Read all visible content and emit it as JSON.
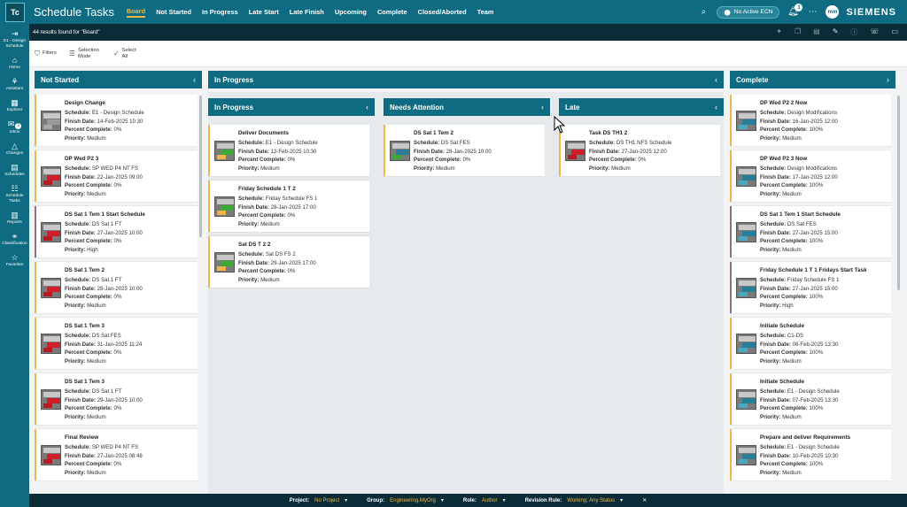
{
  "app": {
    "logo": "Tc",
    "title": "Schedule Tasks"
  },
  "nav_tabs": [
    {
      "label": "Board",
      "active": true
    },
    {
      "label": "Not Started",
      "active": false
    },
    {
      "label": "In Progress",
      "active": false
    },
    {
      "label": "Late Start",
      "active": false
    },
    {
      "label": "Late Finish",
      "active": false
    },
    {
      "label": "Upcoming",
      "active": false
    },
    {
      "label": "Complete",
      "active": false
    },
    {
      "label": "Closed/Aborted",
      "active": false
    },
    {
      "label": "Team",
      "active": false
    }
  ],
  "header": {
    "ecn_label": "No Active ECN",
    "notif_count": "1",
    "avatar_initials": "mm",
    "brand": "SIEMENS"
  },
  "sidebar": [
    {
      "label": "E1 - Design Schedule",
      "icon": "arrow-icon"
    },
    {
      "label": "Home",
      "icon": "home-icon"
    },
    {
      "label": "Assistant",
      "icon": "assistant-icon"
    },
    {
      "label": "Explorer",
      "icon": "explorer-icon"
    },
    {
      "label": "Inbox",
      "icon": "inbox-icon",
      "badge": "3"
    },
    {
      "label": "Changes",
      "icon": "changes-icon"
    },
    {
      "label": "Schedules",
      "icon": "schedules-icon"
    },
    {
      "label": "Schedule Tasks",
      "icon": "schedule-tasks-icon"
    },
    {
      "label": "Reports",
      "icon": "reports-icon"
    },
    {
      "label": "Classification",
      "icon": "classification-icon"
    },
    {
      "label": "Favorites",
      "icon": "favorites-icon"
    }
  ],
  "results": {
    "text": "44 results found for \"Board\""
  },
  "toolbar": {
    "filters": "Filters",
    "selection_mode": "Selection Mode",
    "select_all": "Select All"
  },
  "labels": {
    "schedule": "Schedule:",
    "finish": "Finish Date:",
    "percent": "Percent Complete:",
    "priority": "Priority:"
  },
  "columns": {
    "not_started": {
      "title": "Not Started",
      "cards": [
        {
          "title": "Design Change",
          "schedule": "E1 - Design Schedule",
          "finish": "14-Feb-2025 10:30",
          "percent": "0%",
          "priority": "Medium",
          "thumb": "grey"
        },
        {
          "title": "DP Wed P2 3",
          "schedule": "SP WED P4 NT FS",
          "finish": "22-Jan-2025 09:00",
          "percent": "0%",
          "priority": "Medium",
          "thumb": "red"
        },
        {
          "title": "DS Sat 1 Tem 1 Start Schedule",
          "schedule": "DS Sat 1 FT",
          "finish": "27-Jan-2025 10:00",
          "percent": "0%",
          "priority": "High",
          "thumb": "red",
          "border": "purple"
        },
        {
          "title": "DS Sat 1 Tem 2",
          "schedule": "DS Sat 1 FT",
          "finish": "28-Jan-2025 10:00",
          "percent": "0%",
          "priority": "Medium",
          "thumb": "red"
        },
        {
          "title": "DS Sat 1 Tem 3",
          "schedule": "DS Sat FES",
          "finish": "31-Jan-2025 11:24",
          "percent": "0%",
          "priority": "Medium",
          "thumb": "red"
        },
        {
          "title": "DS Sat 1 Tem 3",
          "schedule": "DS Sat 1 FT",
          "finish": "29-Jan-2025 10:00",
          "percent": "0%",
          "priority": "Medium",
          "thumb": "red"
        },
        {
          "title": "Final Review",
          "schedule": "SP WED P4 NT FS",
          "finish": "27-Jan-2025 08:48",
          "percent": "0%",
          "priority": "Medium",
          "thumb": "red"
        }
      ]
    },
    "in_progress_group": {
      "title": "In Progress"
    },
    "in_progress": {
      "title": "In Progress",
      "cards": [
        {
          "title": "Deliver Documents",
          "schedule": "E1 - Design Schedule",
          "finish": "12-Feb-2025 10:30",
          "percent": "0%",
          "priority": "Medium",
          "thumb": "green"
        },
        {
          "title": "Friday Schedule 1 T 2",
          "schedule": "Friday Schedule FS 1",
          "finish": "28-Jan-2025 17:00",
          "percent": "0%",
          "priority": "Medium",
          "thumb": "green"
        },
        {
          "title": "Sat DS T 2 2",
          "schedule": "Sat DS FS 2",
          "finish": "29-Jan-2025 17:00",
          "percent": "0%",
          "priority": "Medium",
          "thumb": "green"
        }
      ]
    },
    "needs_attention": {
      "title": "Needs Attention",
      "cards": [
        {
          "title": "DS Sat 1 Tem 2",
          "schedule": "DS Sat FES",
          "finish": "28-Jan-2025 10:00",
          "percent": "0%",
          "priority": "Medium",
          "thumb": "yellow"
        }
      ]
    },
    "late": {
      "title": "Late",
      "cards": [
        {
          "title": "Task DS TH1 2",
          "schedule": "DS TH1 NFS Schedule",
          "finish": "27-Jan-2025 12:00",
          "percent": "0%",
          "priority": "Medium",
          "thumb": "red"
        }
      ]
    },
    "complete": {
      "title": "Complete",
      "cards": [
        {
          "title": "DP Wed P2 2 Now",
          "schedule": "Design Modifications",
          "finish": "16-Jan-2025 12:00",
          "percent": "100%",
          "priority": "Medium",
          "thumb": "blue"
        },
        {
          "title": "DP Wed P2 3 Now",
          "schedule": "Design Modifications",
          "finish": "17-Jan-2025 12:00",
          "percent": "100%",
          "priority": "Medium",
          "thumb": "blue"
        },
        {
          "title": "DS Sat 1 Tem 1 Start Schedule",
          "schedule": "DS Sat FES",
          "finish": "27-Jan-2025 15:00",
          "percent": "100%",
          "priority": "Medium",
          "thumb": "blue",
          "border": "purple"
        },
        {
          "title": "Friday Schedule 1 T 1 Fridays Start Task",
          "schedule": "Friday Schedule FS 1",
          "finish": "27-Jan-2025 15:00",
          "percent": "100%",
          "priority": "High",
          "thumb": "blue",
          "border": "purple"
        },
        {
          "title": "Initiate Schedule",
          "schedule": "C1-DS",
          "finish": "06-Feb-2025 13:30",
          "percent": "100%",
          "priority": "Medium",
          "thumb": "blue"
        },
        {
          "title": "Initiate Schedule",
          "schedule": "E1 - Design Schedule",
          "finish": "07-Feb-2025 13:30",
          "percent": "100%",
          "priority": "Medium",
          "thumb": "blue"
        },
        {
          "title": "Prepare and deliver Requirements",
          "schedule": "E1 - Design Schedule",
          "finish": "10-Feb-2025 10:30",
          "percent": "100%",
          "priority": "Medium",
          "thumb": "blue"
        }
      ]
    }
  },
  "statusbar": {
    "project_label": "Project:",
    "project_value": "No Project",
    "group_label": "Group:",
    "group_value": "Engineering.MyOrg",
    "role_label": "Role:",
    "role_value": "Author",
    "revision_label": "Revision Rule:",
    "revision_value": "Working; Any Status"
  },
  "colors": {
    "accent": "#0e6b82",
    "highlight": "#f4b73b",
    "dark_bar": "#0b2c36"
  }
}
